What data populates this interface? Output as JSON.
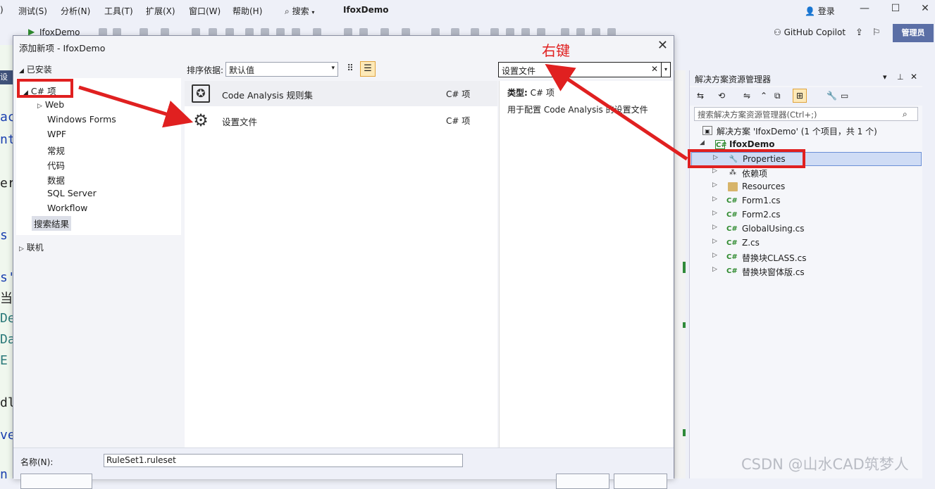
{
  "menubar": {
    "items": [
      "测试(S)",
      "分析(N)",
      "工具(T)",
      "扩展(X)",
      "窗口(W)",
      "帮助(H)"
    ],
    "search_label": "搜索",
    "app_title": "IfoxDemo",
    "login": "登录"
  },
  "toolbar": {
    "run_target": "IfoxDemo",
    "copilot": "GitHub Copilot",
    "admin": "管理员"
  },
  "editor_fragments": [
    "ac",
    "nt",
    "er",
    "s",
    "s'",
    "当",
    "De",
    "Da",
    "E",
    "dl",
    "ve",
    "n"
  ],
  "solution_explorer": {
    "title": "解决方案资源管理器",
    "search_placeholder": "搜索解决方案资源管理器(Ctrl+;)",
    "solution": "解决方案 'IfoxDemo' (1 个项目，共 1 个)",
    "project": "IfoxDemo",
    "nodes": [
      "Properties",
      "依赖项",
      "Resources",
      "Form1.cs",
      "Form2.cs",
      "GlobalUsing.cs",
      "Z.cs",
      "替换块CLASS.cs",
      "替换块窗体版.cs"
    ]
  },
  "dialog": {
    "title": "添加新项 - IfoxDemo",
    "installed": "已安装",
    "categories": [
      "C# 项",
      "Web",
      "Windows Forms",
      "WPF",
      "常规",
      "代码",
      "数据",
      "SQL Server",
      "Workflow",
      "搜索结果"
    ],
    "online": "联机",
    "sort_label": "排序依据:",
    "sort_value": "默认值",
    "search_value": "设置文件",
    "items": [
      {
        "name": "Code Analysis 规则集",
        "type": "C# 项",
        "icon": "ruleset-icon"
      },
      {
        "name": "设置文件",
        "type": "C# 项",
        "icon": "gear-icon"
      }
    ],
    "detail_type_label": "类型:",
    "detail_type_value": "C# 项",
    "detail_desc": "用于配置 Code Analysis 的设置文件",
    "name_label": "名称(N):",
    "name_value": "RuleSet1.ruleset"
  },
  "annotation": {
    "text": "右键",
    "color": "#e02020"
  },
  "watermark": "CSDN @山水CAD筑梦人"
}
